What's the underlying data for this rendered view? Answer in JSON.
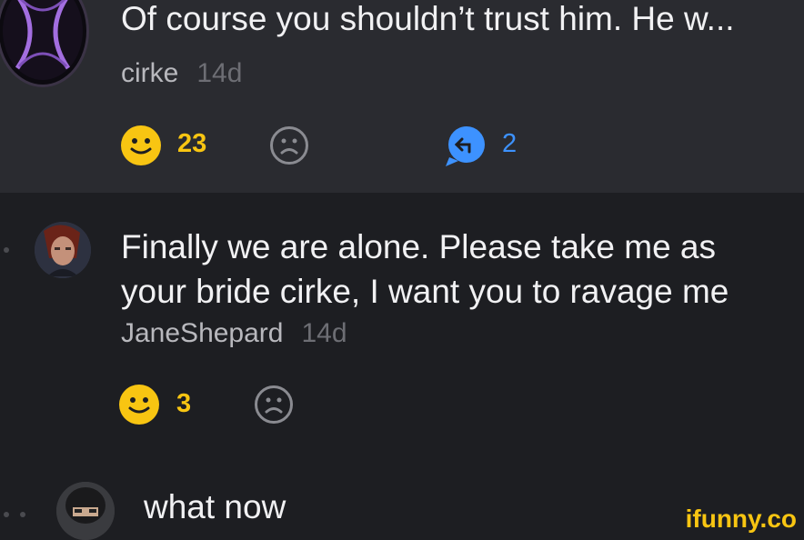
{
  "comments": [
    {
      "text": "Of course you shouldn’t trust him. He w...",
      "author": "cirke",
      "time": "14d",
      "likes": "23",
      "replies": "2"
    },
    {
      "text_line1": "Finally we are alone. Please take me as",
      "text_line2": "your bride cirke, I want you to ravage me",
      "author": "JaneShepard",
      "time": "14d",
      "likes": "3"
    },
    {
      "text": "what now"
    }
  ],
  "watermark": "ifunny.co",
  "colors": {
    "accent_yellow": "#f8c512",
    "reply_blue": "#3d92ff",
    "background": "#1d1e22",
    "highlight_background": "#2a2b30"
  },
  "icons": {
    "like": "smile-icon",
    "dislike": "frown-icon",
    "reply": "reply-bubble-icon"
  }
}
